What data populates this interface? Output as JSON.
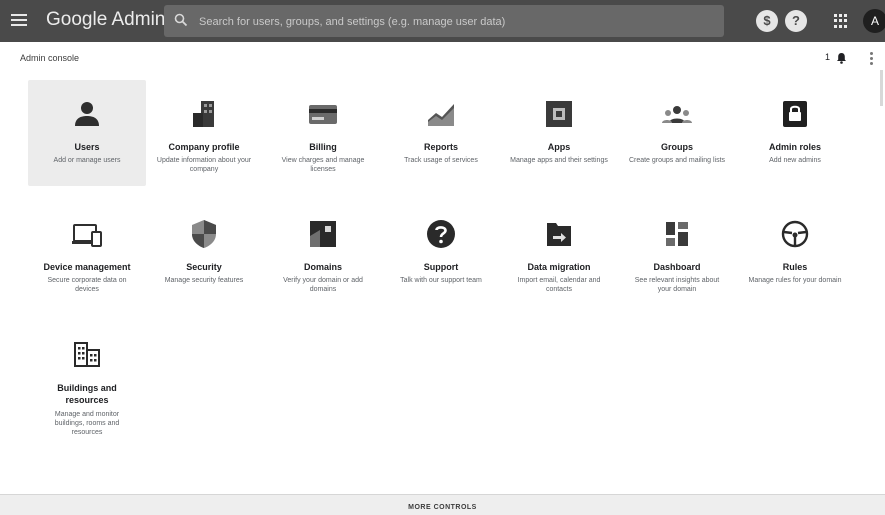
{
  "topbar": {
    "brand": "Google Admin",
    "search_placeholder": "Search for users, groups, and settings (e.g. manage user data)",
    "dollar_label": "$",
    "help_label": "?",
    "avatar_letter": "A"
  },
  "breadcrumb": "Admin console",
  "notifications": {
    "count": "1"
  },
  "tiles": [
    {
      "title": "Users",
      "desc": "Add or manage users",
      "icon": "person-icon"
    },
    {
      "title": "Company profile",
      "desc": "Update information about your company",
      "icon": "building-icon"
    },
    {
      "title": "Billing",
      "desc": "View charges and manage licenses",
      "icon": "credit-card-icon"
    },
    {
      "title": "Reports",
      "desc": "Track usage of services",
      "icon": "chart-icon"
    },
    {
      "title": "Apps",
      "desc": "Manage apps and their settings",
      "icon": "apps-icon"
    },
    {
      "title": "Groups",
      "desc": "Create groups and mailing lists",
      "icon": "groups-icon"
    },
    {
      "title": "Admin roles",
      "desc": "Add new admins",
      "icon": "lock-icon"
    },
    {
      "title": "Device management",
      "desc": "Secure corporate data on devices",
      "icon": "devices-icon"
    },
    {
      "title": "Security",
      "desc": "Manage security features",
      "icon": "shield-icon"
    },
    {
      "title": "Domains",
      "desc": "Verify your domain or add domains",
      "icon": "domain-icon"
    },
    {
      "title": "Support",
      "desc": "Talk with our support team",
      "icon": "help-icon"
    },
    {
      "title": "Data migration",
      "desc": "Import email, calendar and contacts",
      "icon": "migration-icon"
    },
    {
      "title": "Dashboard",
      "desc": "See relevant insights about your domain",
      "icon": "dashboard-icon"
    },
    {
      "title": "Rules",
      "desc": "Manage rules for your domain",
      "icon": "steering-wheel-icon"
    },
    {
      "title": "Buildings and resources",
      "desc": "Manage and monitor buildings, rooms and resources",
      "icon": "buildings-icon"
    }
  ],
  "footer": {
    "more_controls": "MORE CONTROLS"
  }
}
